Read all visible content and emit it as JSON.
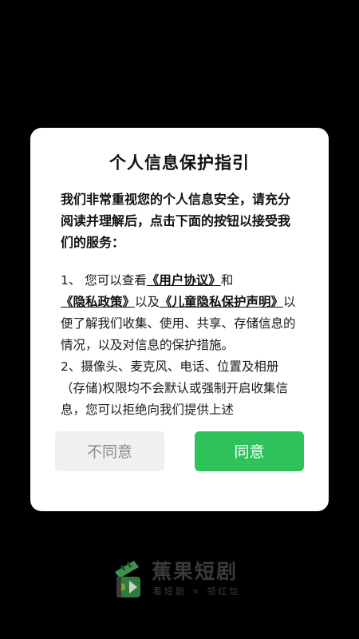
{
  "dialog": {
    "title": "个人信息保护指引",
    "intro": "我们非常重视您的个人信息安全，请充分阅读并理解后，点击下面的按钮以接受我们的服务：",
    "p1": {
      "prefix": " 1、 您可以查看",
      "link_user_agreement": "《用户协议》",
      "and": "和",
      "link_privacy_policy": "《隐私政策》",
      "also": "以及",
      "link_child_privacy": "《儿童隐私保护声明》",
      "suffix": "以便了解我们收集、使用、共享、存储信息的情况，以及对信息的保护措施。"
    },
    "p2": " 2、摄像头、麦克风、电话、位置及相册（存储)权限均不会默认或强制开启收集信息，您可以拒绝向我们提供上述",
    "disagree_label": "不同意",
    "agree_label": "同意"
  },
  "brand": {
    "name": "蕉果短剧",
    "slogan": "看短剧 × 领红包"
  },
  "colors": {
    "background": "#000000",
    "dialog": "#ffffff",
    "agree_button": "#2fc25b",
    "disagree_button": "#f0f0f0",
    "brand_text": "#3a3a3a"
  },
  "icons": {
    "brand_logo": "film-clip-logo-icon"
  }
}
